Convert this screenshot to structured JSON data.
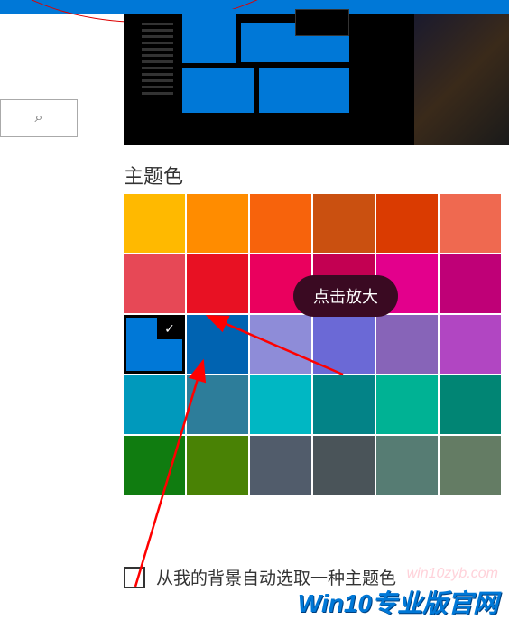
{
  "section_title": "主题色",
  "tooltip": "点击放大",
  "checkbox_label": "从我的背景自动选取一种主题色",
  "watermark1": "win10zyb.com",
  "watermark2": "Win10专业版官网",
  "selected_index": 12,
  "colors": [
    "#ffb900",
    "#ff8c00",
    "#f7630c",
    "#ca5010",
    "#da3b01",
    "#ef6950",
    "#e74856",
    "#e81123",
    "#ea005e",
    "#c30052",
    "#e3008c",
    "#bf0077",
    "#0078d7",
    "#0063b1",
    "#8e8cd8",
    "#6b69d6",
    "#8764b8",
    "#b146c2",
    "#0099bc",
    "#2d7d9a",
    "#00b7c3",
    "#038387",
    "#00b294",
    "#018574",
    "#107c10",
    "#498205",
    "#515c6b",
    "#4a5459",
    "#567c73",
    "#647c64"
  ]
}
